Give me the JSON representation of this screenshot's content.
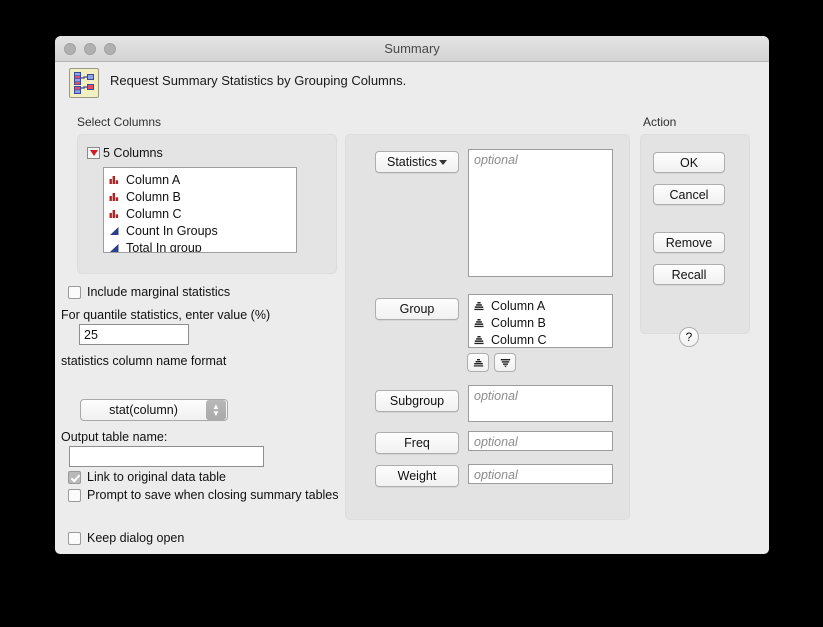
{
  "window": {
    "title": "Summary",
    "traffic_lights": [
      "close-button",
      "minimize-button",
      "zoom-button"
    ]
  },
  "header": {
    "icon": "summary-table-icon",
    "text": "Request Summary Statistics by Grouping Columns."
  },
  "select_columns": {
    "caption": "Select Columns",
    "disclosure": "disclosure-triangle-icon",
    "count_label": "5 Columns",
    "columns": [
      {
        "label": "Column A",
        "type": "nominal",
        "icon": "nominal-bars-icon"
      },
      {
        "label": "Column B",
        "type": "nominal",
        "icon": "nominal-bars-icon"
      },
      {
        "label": "Column C",
        "type": "nominal",
        "icon": "nominal-bars-icon"
      },
      {
        "label": "Count In Groups",
        "type": "continuous",
        "icon": "continuous-triangle-icon"
      },
      {
        "label": "Total In group",
        "type": "continuous",
        "icon": "continuous-triangle-icon"
      }
    ]
  },
  "options": {
    "include_marginal": {
      "label": "Include marginal statistics",
      "checked": false
    },
    "quantile_label": "For quantile statistics, enter value (%)",
    "quantile_value": "25",
    "format_label": "statistics column name format",
    "format_value": "stat(column)",
    "output_table_label": "Output table name:",
    "output_table_value": "",
    "link_original": {
      "label": "Link to original data table",
      "checked": true
    },
    "prompt_save": {
      "label": "Prompt to save when closing summary tables",
      "checked": false
    },
    "keep_dialog_open": {
      "label": "Keep dialog open",
      "checked": false
    }
  },
  "roles": {
    "statistics": {
      "button": "Statistics",
      "has_menu": true,
      "placeholder": "optional",
      "items": []
    },
    "group": {
      "button": "Group",
      "placeholder": "",
      "items": [
        {
          "label": "Column A",
          "icon": "ordinal-icon"
        },
        {
          "label": "Column B",
          "icon": "ordinal-icon"
        },
        {
          "label": "Column C",
          "icon": "ordinal-icon"
        }
      ],
      "sort_ascending_icon": "sort-ascending-icon",
      "sort_descending_icon": "sort-descending-icon"
    },
    "subgroup": {
      "button": "Subgroup",
      "placeholder": "optional",
      "items": []
    },
    "freq": {
      "button": "Freq",
      "placeholder": "optional",
      "items": []
    },
    "weight": {
      "button": "Weight",
      "placeholder": "optional",
      "items": []
    }
  },
  "action": {
    "caption": "Action",
    "ok": "OK",
    "cancel": "Cancel",
    "remove": "Remove",
    "recall": "Recall",
    "help": "?"
  },
  "colors": {
    "window_bg": "#ececec",
    "panel_bg": "#e3e3e3",
    "nominal_icon": "#b22222",
    "continuous_icon": "#2b3f8c",
    "disclosure_red": "#cc2020"
  }
}
